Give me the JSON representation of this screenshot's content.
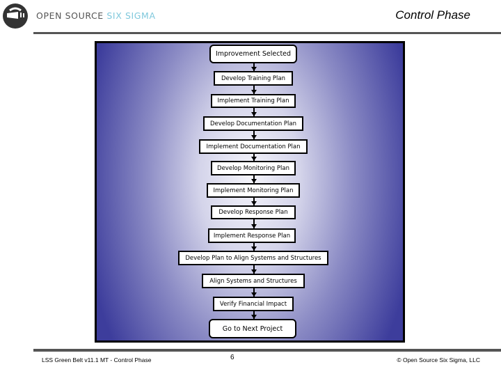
{
  "header": {
    "logo_icon": "open-source-six-sigma-logo-icon",
    "brand_primary": "OPEN SOURCE ",
    "brand_accent": "SIX SIGMA",
    "title": "Control Phase"
  },
  "diagram": {
    "steps": [
      {
        "label": "Improvement Selected",
        "type": "terminal"
      },
      {
        "label": "Develop Training Plan",
        "type": "process"
      },
      {
        "label": "Implement Training Plan",
        "type": "process"
      },
      {
        "label": "Develop Documentation Plan",
        "type": "process"
      },
      {
        "label": "Implement Documentation Plan",
        "type": "process"
      },
      {
        "label": "Develop Monitoring Plan",
        "type": "process"
      },
      {
        "label": "Implement Monitoring Plan",
        "type": "process"
      },
      {
        "label": "Develop Response Plan",
        "type": "process"
      },
      {
        "label": "Implement Response Plan",
        "type": "process"
      },
      {
        "label": "Develop Plan to Align Systems and Structures",
        "type": "process"
      },
      {
        "label": "Align Systems and Structures",
        "type": "process"
      },
      {
        "label": "Verify Financial Impact",
        "type": "process"
      },
      {
        "label": "Go to Next Project",
        "type": "terminal"
      }
    ]
  },
  "footer": {
    "left": "LSS Green Belt v11.1 MT - Control Phase",
    "page": "6",
    "right": "© Open Source Six Sigma, LLC"
  },
  "colors": {
    "accent": "#7fc8dc",
    "rule": "#555555",
    "diagram_edge": "#3d3d9c",
    "diagram_center": "#f4f4fa"
  }
}
